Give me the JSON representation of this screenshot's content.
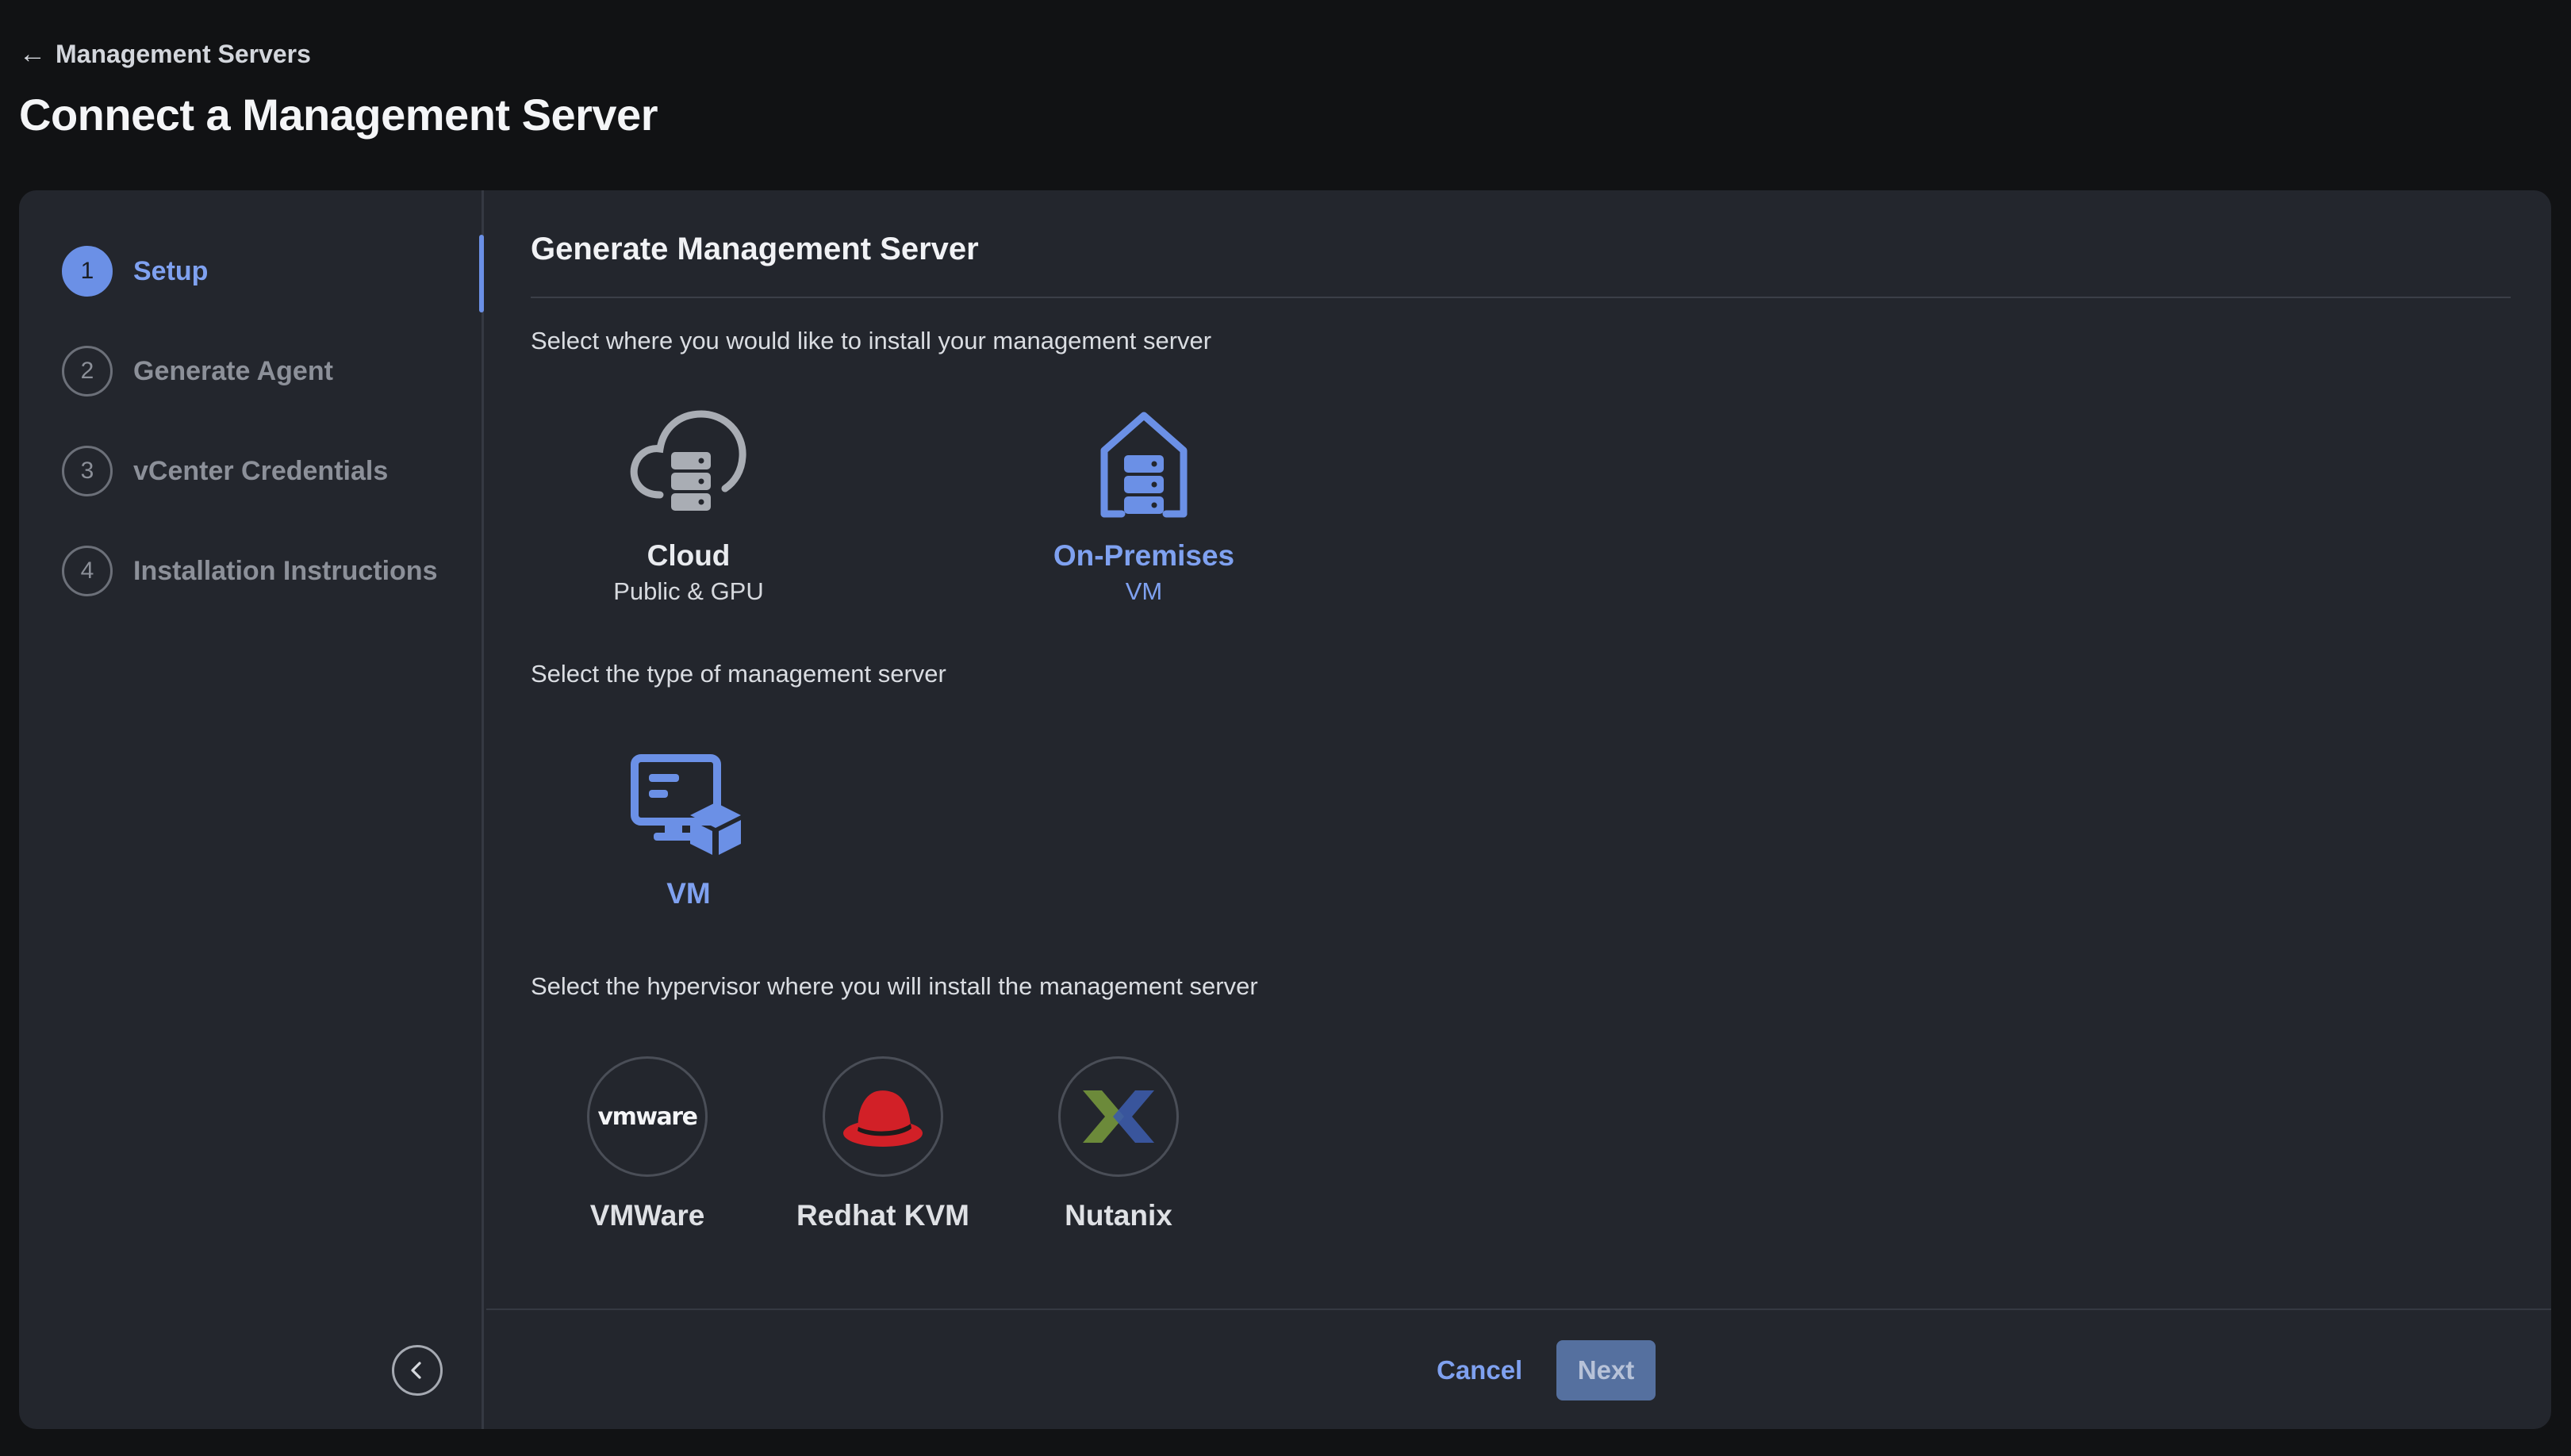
{
  "header": {
    "back_label": "Management Servers",
    "title": "Connect a Management Server"
  },
  "steps": [
    {
      "number": "1",
      "label": "Setup",
      "active": true
    },
    {
      "number": "2",
      "label": "Generate Agent",
      "active": false
    },
    {
      "number": "3",
      "label": "vCenter Credentials",
      "active": false
    },
    {
      "number": "4",
      "label": "Installation Instructions",
      "active": false
    }
  ],
  "main": {
    "section_title": "Generate Management Server",
    "install_location": {
      "prompt": "Select where you would like to install your management server",
      "options": [
        {
          "title": "Cloud",
          "subtitle": "Public & GPU",
          "icon": "cloud-server-icon",
          "selected": false
        },
        {
          "title": "On-Premises",
          "subtitle": "VM",
          "icon": "house-server-icon",
          "selected": true
        }
      ]
    },
    "server_type": {
      "prompt": "Select the type of management server",
      "options": [
        {
          "title": "VM",
          "icon": "vm-icon",
          "selected": true
        }
      ]
    },
    "hypervisor": {
      "prompt": "Select the hypervisor where you will install the management server",
      "options": [
        {
          "label": "VMWare",
          "logo_text": "vmware",
          "icon": "vmware-logo"
        },
        {
          "label": "Redhat KVM",
          "icon": "redhat-hat-icon"
        },
        {
          "label": "Nutanix",
          "icon": "nutanix-x-icon"
        }
      ]
    }
  },
  "footer": {
    "cancel_label": "Cancel",
    "next_label": "Next",
    "next_disabled": true
  },
  "colors": {
    "accent": "#6b90e6",
    "accent_text": "#7fa1f0",
    "background": "#111214",
    "card": "#23262d",
    "redhat_red": "#d22027",
    "nutanix_green": "#6c8a3a",
    "nutanix_blue": "#3c5ba8"
  }
}
